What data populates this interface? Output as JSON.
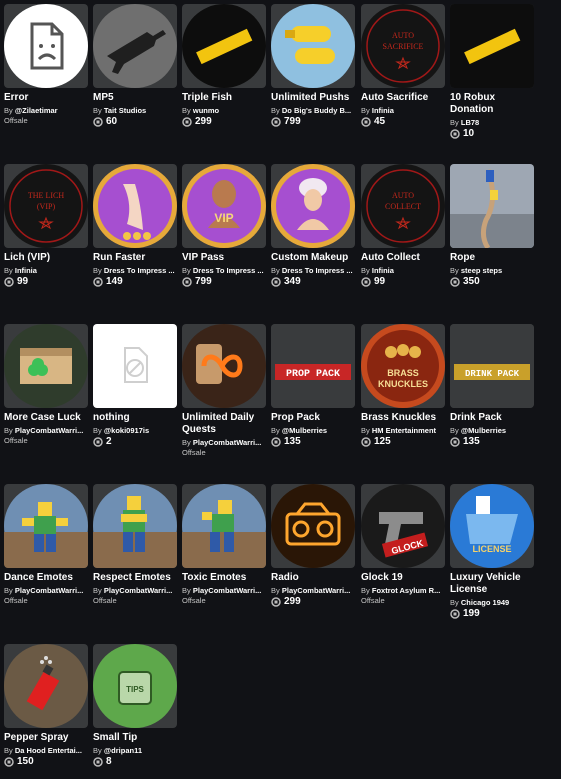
{
  "items": [
    {
      "name": "Error",
      "by": "By",
      "creator": "@Zilaetimar",
      "status": "Offsale",
      "price": null,
      "icon": "broken-file-icon"
    },
    {
      "name": "MP5",
      "by": "By",
      "creator": "Tait Studios",
      "status": null,
      "price": "60",
      "icon": "gun-icon"
    },
    {
      "name": "Triple Fish",
      "by": "By",
      "creator": "wunmo",
      "status": null,
      "price": "299",
      "icon": "ticket-icon"
    },
    {
      "name": "Unlimited Pushs",
      "by": "By",
      "creator": "Do Big's Buddy B...",
      "status": null,
      "price": "799",
      "icon": "push-icon"
    },
    {
      "name": "Auto Sacrifice",
      "by": "By",
      "creator": "Infinia",
      "status": null,
      "price": "45",
      "icon": "pentagram-icon",
      "art_text": [
        "AUTO",
        "SACRIFICE"
      ]
    },
    {
      "name": "10 Robux Donation",
      "by": "By",
      "creator": "LB78",
      "status": null,
      "price": "10",
      "icon": "ticket-icon"
    },
    {
      "name": "Lich (VIP)",
      "by": "By",
      "creator": "Infinia",
      "status": null,
      "price": "99",
      "icon": "pentagram-icon",
      "art_text": [
        "THE LICH",
        "(VIP)"
      ]
    },
    {
      "name": "Run Faster",
      "by": "By",
      "creator": "Dress To Impress ...",
      "status": null,
      "price": "149",
      "icon": "heels-icon"
    },
    {
      "name": "VIP Pass",
      "by": "By",
      "creator": "Dress To Impress ...",
      "status": null,
      "price": "799",
      "icon": "vip-mannequin-icon",
      "art_text": [
        "VIP"
      ]
    },
    {
      "name": "Custom Makeup",
      "by": "By",
      "creator": "Dress To Impress ...",
      "status": null,
      "price": "349",
      "icon": "mannequin-icon"
    },
    {
      "name": "Auto Collect",
      "by": "By",
      "creator": "Infinia",
      "status": null,
      "price": "99",
      "icon": "pentagram-icon",
      "art_text": [
        "AUTO",
        "COLLECT"
      ]
    },
    {
      "name": "Rope",
      "by": "By",
      "creator": "steep steps",
      "status": null,
      "price": "350",
      "icon": "rope-icon"
    },
    {
      "name": "More Case Luck",
      "by": "By",
      "creator": "PlayCombatWarri...",
      "status": "Offsale",
      "price": null,
      "icon": "clover-case-icon"
    },
    {
      "name": "nothing",
      "by": "By",
      "creator": "@koki0917is",
      "status": null,
      "price": "2",
      "icon": "blocked-file-icon"
    },
    {
      "name": "Unlimited Daily Quests",
      "by": "By",
      "creator": "PlayCombatWarri...",
      "status": "Offsale",
      "price": null,
      "icon": "scroll-infinity-icon"
    },
    {
      "name": "Prop Pack",
      "by": "By",
      "creator": "@Mulberries",
      "status": null,
      "price": "135",
      "icon": "text-banner-icon",
      "art_text": [
        "PROP PACK"
      ]
    },
    {
      "name": "Brass Knuckles",
      "by": "By",
      "creator": "HM Entertainment",
      "status": null,
      "price": "125",
      "icon": "knuckles-icon",
      "art_text": [
        "BRASS",
        "KNUCKLES"
      ]
    },
    {
      "name": "Drink Pack",
      "by": "By",
      "creator": "@Mulberries",
      "status": null,
      "price": "135",
      "icon": "text-banner-icon",
      "art_text": [
        "DRINK PACK"
      ]
    },
    {
      "name": "Dance Emotes",
      "by": "By",
      "creator": "PlayCombatWarri...",
      "status": "Offsale",
      "price": null,
      "icon": "avatar-emote-icon"
    },
    {
      "name": "Respect Emotes",
      "by": "By",
      "creator": "PlayCombatWarri...",
      "status": "Offsale",
      "price": null,
      "icon": "avatar-emote-icon"
    },
    {
      "name": "Toxic Emotes",
      "by": "By",
      "creator": "PlayCombatWarri...",
      "status": "Offsale",
      "price": null,
      "icon": "avatar-emote-icon"
    },
    {
      "name": "Radio",
      "by": "By",
      "creator": "PlayCombatWarri...",
      "status": null,
      "price": "299",
      "icon": "radio-icon"
    },
    {
      "name": "Glock 19",
      "by": "By",
      "creator": "Foxtrot Asylum R...",
      "status": "Offsale",
      "price": null,
      "icon": "pistol-icon",
      "art_text": [
        "GLOCK"
      ]
    },
    {
      "name": "Luxury Vehicle License",
      "by": "By",
      "creator": "Chicago 1949",
      "status": null,
      "price": "199",
      "icon": "license-icon",
      "art_text": [
        "LICENSE"
      ]
    },
    {
      "name": "Pepper Spray",
      "by": "By",
      "creator": "Da Hood Entertai...",
      "status": null,
      "price": "150",
      "icon": "spray-icon"
    },
    {
      "name": "Small Tip",
      "by": "By",
      "creator": "@dripan11",
      "status": null,
      "price": "8",
      "icon": "tip-jar-icon",
      "art_text": [
        "TIPS"
      ]
    }
  ]
}
